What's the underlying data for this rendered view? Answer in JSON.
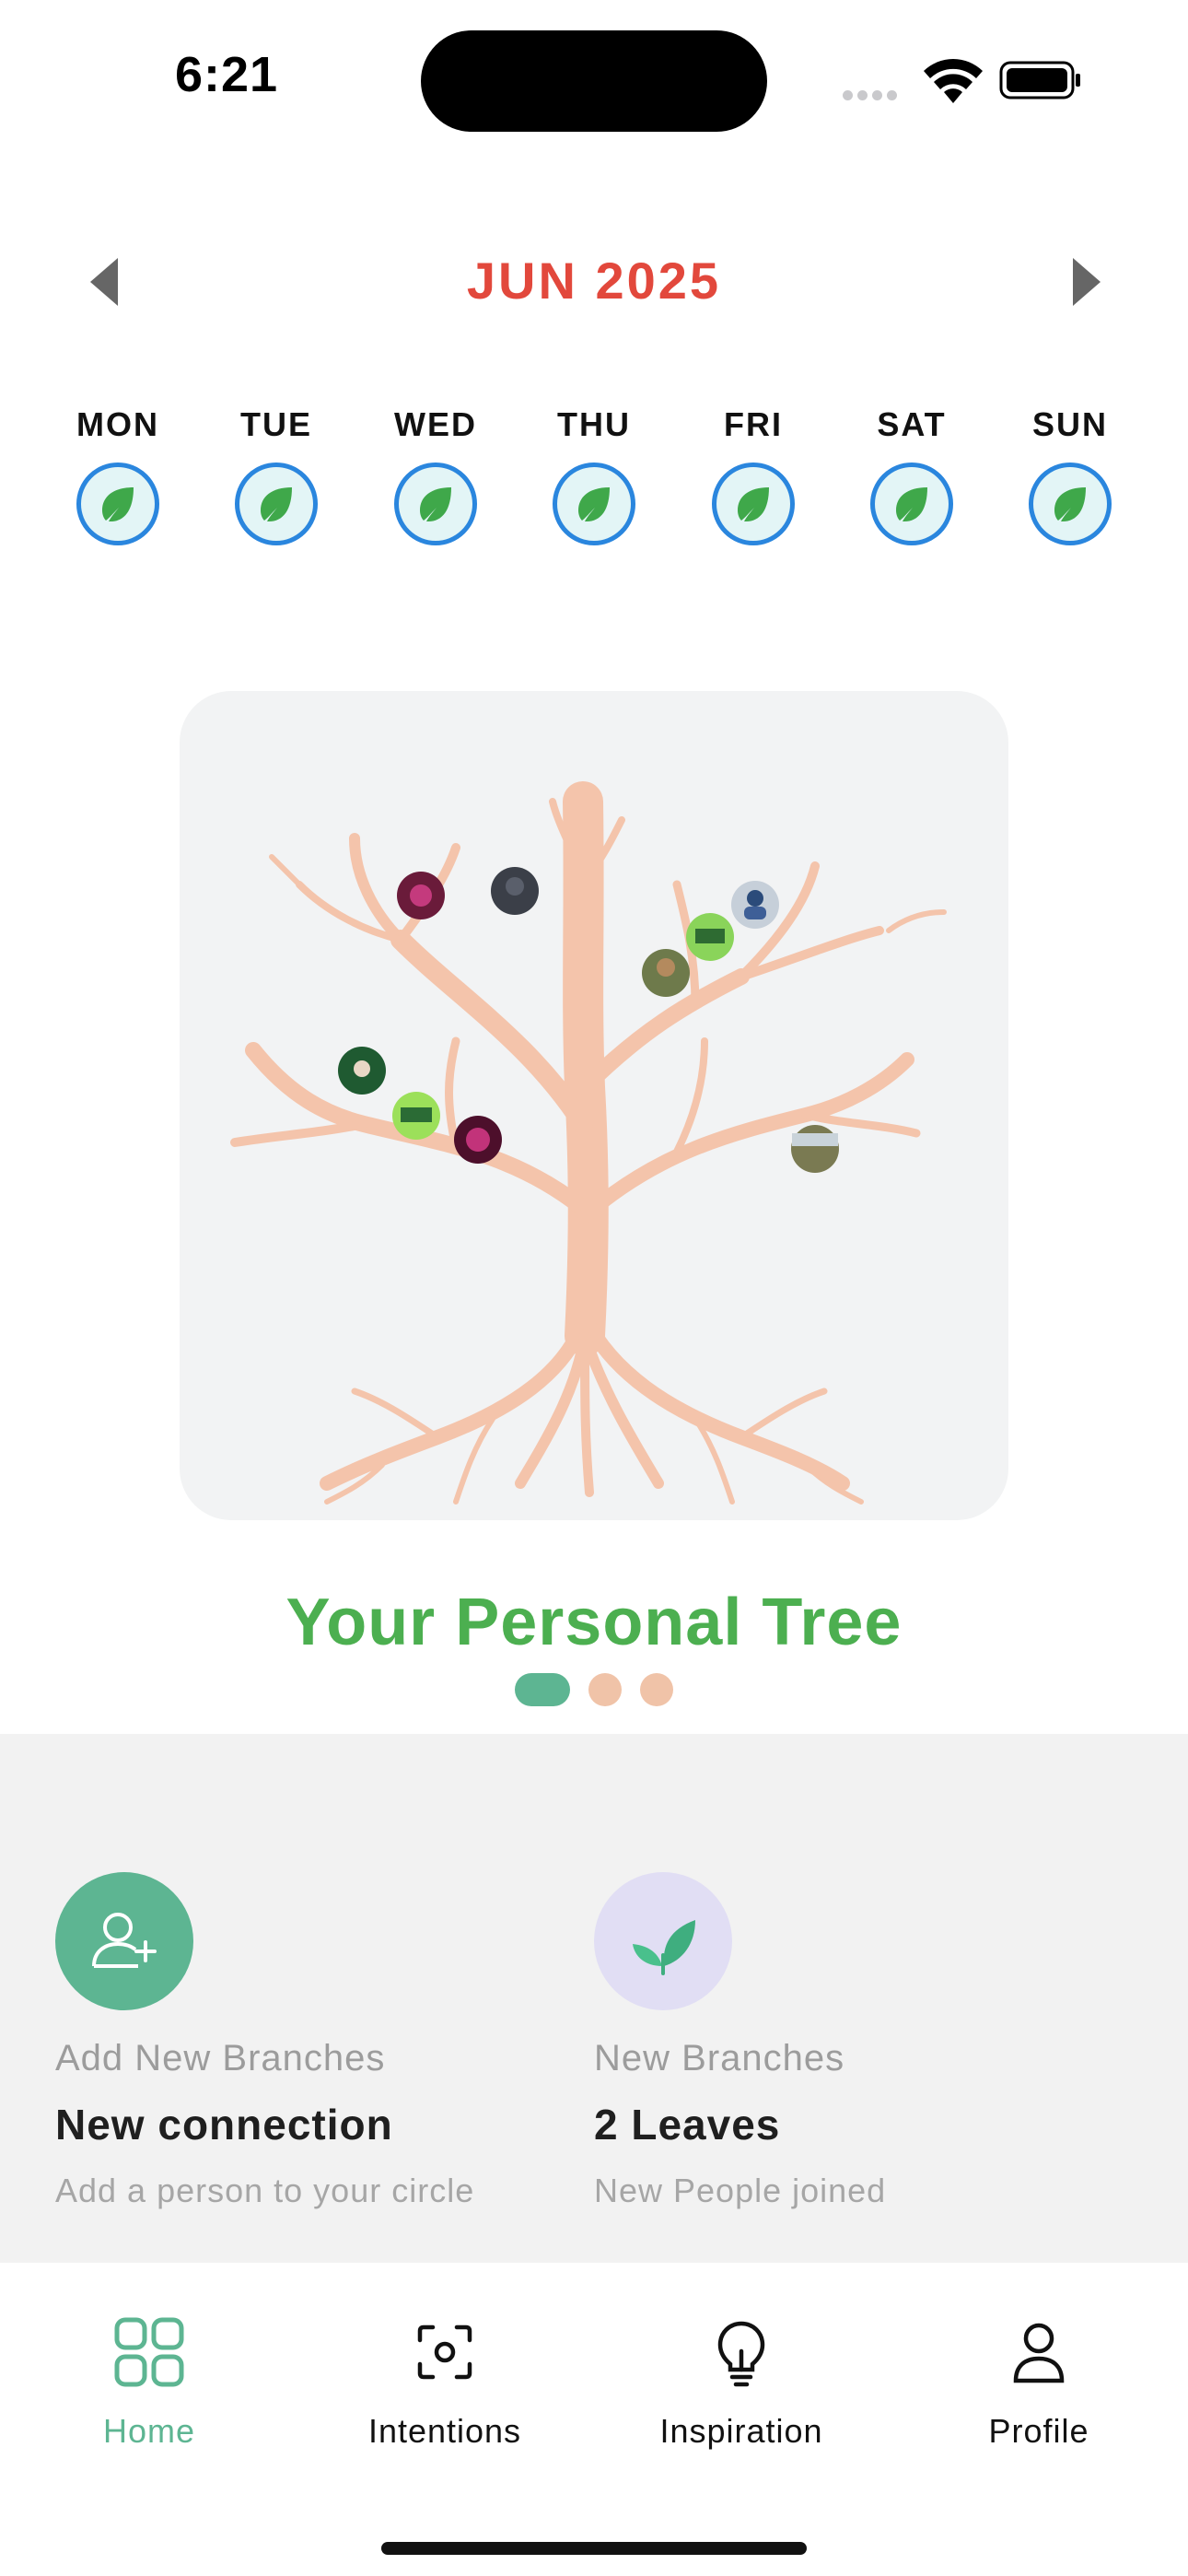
{
  "status_bar": {
    "time": "6:21"
  },
  "calendar": {
    "month_label": "JUN 2025",
    "days": [
      {
        "label": "MON"
      },
      {
        "label": "TUE"
      },
      {
        "label": "WED"
      },
      {
        "label": "THU"
      },
      {
        "label": "FRI"
      },
      {
        "label": "SAT"
      },
      {
        "label": "SUN"
      }
    ]
  },
  "tree": {
    "title": "Your Personal Tree",
    "carousel_page": 1,
    "carousel_total": 3
  },
  "stats": [
    {
      "caption": "Add New Branches",
      "title": "New connection",
      "subtitle": "Add a person to your circle",
      "icon": "add-person-icon",
      "icon_bg": "#5db592"
    },
    {
      "caption": "New Branches",
      "title": "2 Leaves",
      "subtitle": "New People joined",
      "icon": "leaf-icon",
      "icon_bg": "#e1def4"
    }
  ],
  "tabs": [
    {
      "label": "Home",
      "icon": "grid-icon",
      "active": true
    },
    {
      "label": "Intentions",
      "icon": "focus-icon",
      "active": false
    },
    {
      "label": "Inspiration",
      "icon": "lightbulb-icon",
      "active": false
    },
    {
      "label": "Profile",
      "icon": "person-icon",
      "active": false
    }
  ],
  "colors": {
    "accent": "#5db592",
    "month": "#e2483c",
    "title": "#4caf50",
    "tree": "#f4c4ab",
    "day_ring": "#2a86de"
  }
}
